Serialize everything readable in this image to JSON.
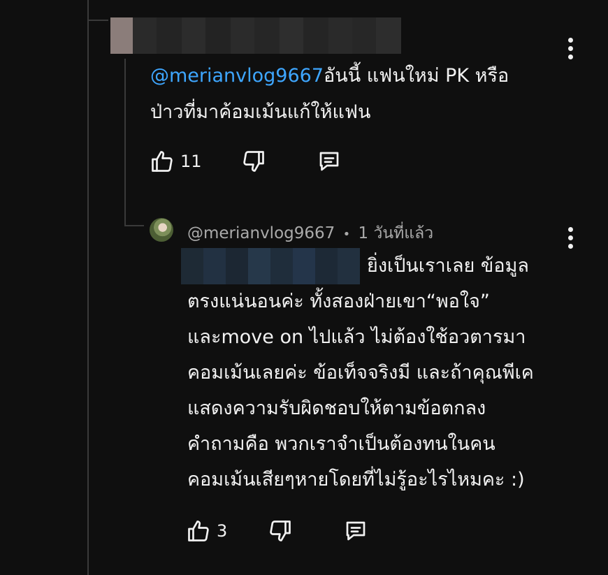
{
  "parent_comment": {
    "mention": "@merianvlog9667",
    "line1_rest": "อันนี้ แฟนใหม่ PK หรือ",
    "line2": "ป่าวที่มาค้อมเม้นแก้ให้แฟน",
    "like_count": "11",
    "icons": [
      "thumbs-up-icon",
      "thumbs-down-icon",
      "reply-icon",
      "more-vert-icon"
    ]
  },
  "reply": {
    "author": "@merianvlog9667",
    "separator": "•",
    "time": "1 วันที่แล้ว",
    "lines": [
      "ยิ่งเป็นเราเลย ข้อมูล",
      "ตรงแน่นอนค่ะ ทั้งสองฝ่ายเขา“พอใจ”",
      "และmove on ไปแล้ว ไม่ต้องใช้อวตารมา",
      "คอมเม้นเลยค่ะ ข้อเท็จจริงมี และถ้าคุณพีเค",
      "แสดงความรับผิดชอบให้ตามข้อตกลง",
      "คำถามคือ พวกเราจำเป็นต้องทนในคน",
      "คอมเม้นเสียๆหายโดยที่ไม่รู้อะไรไหมคะ :)"
    ],
    "like_count": "3",
    "icons": [
      "avatar",
      "thumbs-up-icon",
      "thumbs-down-icon",
      "reply-icon",
      "more-vert-icon"
    ]
  },
  "colors": {
    "background": "#0f0f0f",
    "text": "#f1f1f1",
    "mention": "#3ea6ff",
    "meta": "#aaaaaa",
    "thread_line": "#3a3a3a"
  }
}
